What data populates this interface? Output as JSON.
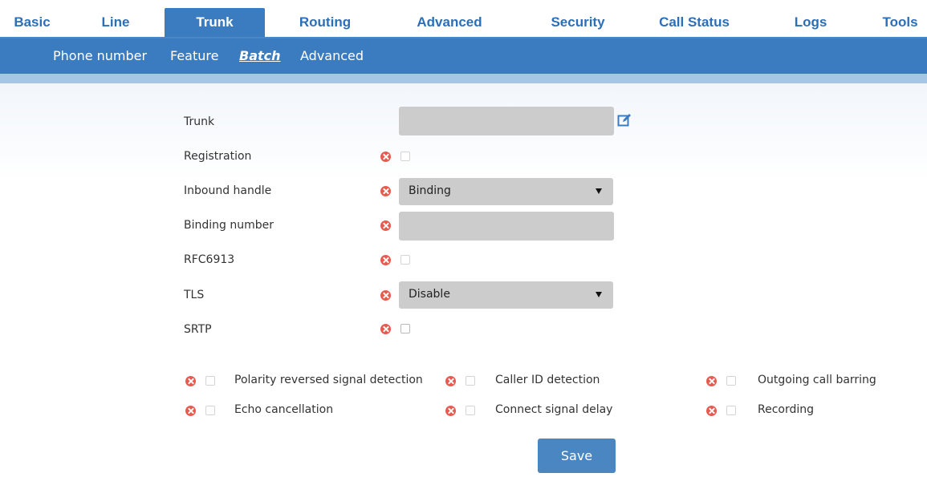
{
  "top_nav": {
    "items": [
      "Basic",
      "Line",
      "Trunk",
      "Routing",
      "Advanced",
      "Security",
      "Call Status",
      "Logs",
      "Tools"
    ],
    "active": "Trunk"
  },
  "sub_nav": {
    "items": [
      "Phone number",
      "Feature",
      "Batch",
      "Advanced"
    ],
    "active": "Batch"
  },
  "form": {
    "trunk_label": "Trunk",
    "trunk_value": "",
    "registration_label": "Registration",
    "inbound_label": "Inbound handle",
    "inbound_value": "Binding",
    "binding_label": "Binding number",
    "binding_value": "",
    "rfc_label": "RFC6913",
    "tls_label": "TLS",
    "tls_value": "Disable",
    "srtp_label": "SRTP"
  },
  "options": {
    "polarity": "Polarity reversed signal detection",
    "caller_id": "Caller ID detection",
    "outgoing_barring": "Outgoing call barring",
    "echo": "Echo cancellation",
    "connect_delay": "Connect signal delay",
    "recording": "Recording"
  },
  "save_label": "Save",
  "colors": {
    "nav_blue": "#3b7cc0",
    "nav_text": "#2a6fb8",
    "strip": "#a6c6e6",
    "error_icon": "#e85a4f",
    "field_bg": "#cccccc",
    "button": "#4a86c2"
  },
  "icons": {
    "edit": "edit-icon",
    "error": "x-circle-icon",
    "dropdown": "triangle-down-icon"
  }
}
